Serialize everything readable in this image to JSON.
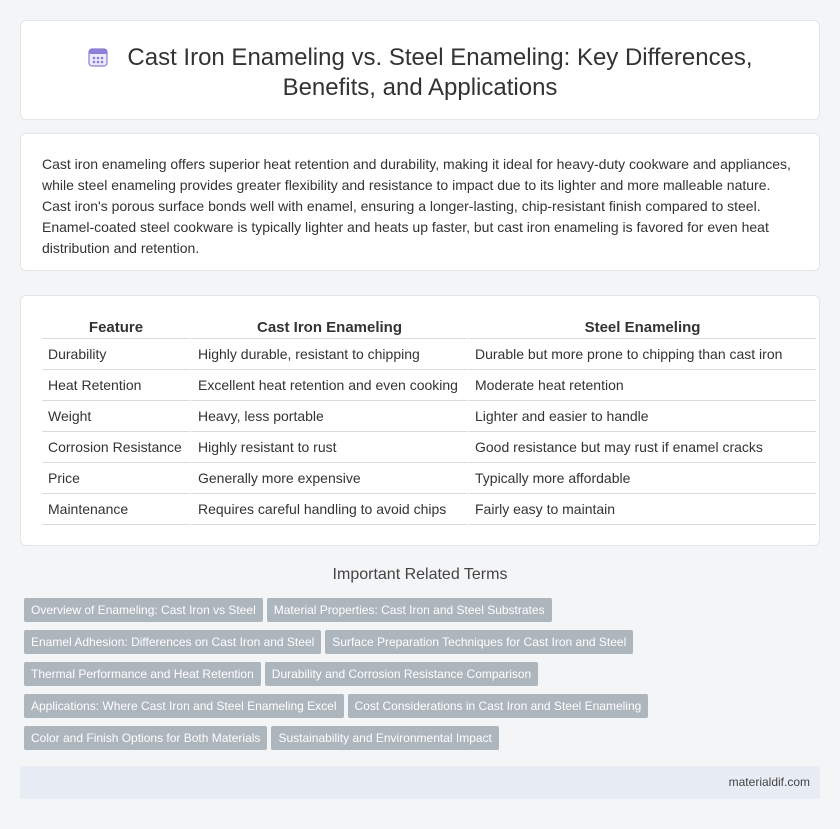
{
  "header": {
    "title_line1": "Cast Iron Enameling vs. Steel Enameling: Key Differences,",
    "title_line2": "Benefits, and Applications",
    "icon": "calendar-grid-icon"
  },
  "summary": "Cast iron enameling offers superior heat retention and durability, making it ideal for heavy-duty cookware and appliances, while steel enameling provides greater flexibility and resistance to impact due to its lighter and more malleable nature. Cast iron's porous surface bonds well with enamel, ensuring a longer-lasting, chip-resistant finish compared to steel. Enamel-coated steel cookware is typically lighter and heats up faster, but cast iron enameling is favored for even heat distribution and retention.",
  "table": {
    "headers": [
      "Feature",
      "Cast Iron Enameling",
      "Steel Enameling"
    ],
    "rows": [
      [
        "Durability",
        "Highly durable, resistant to chipping",
        "Durable but more prone to chipping than cast iron"
      ],
      [
        "Heat Retention",
        "Excellent heat retention and even cooking",
        "Moderate heat retention"
      ],
      [
        "Weight",
        "Heavy, less portable",
        "Lighter and easier to handle"
      ],
      [
        "Corrosion Resistance",
        "Highly resistant to rust",
        "Good resistance but may rust if enamel cracks"
      ],
      [
        "Price",
        "Generally more expensive",
        "Typically more affordable"
      ],
      [
        "Maintenance",
        "Requires careful handling to avoid chips",
        "Fairly easy to maintain"
      ]
    ]
  },
  "related": {
    "title": "Important Related Terms",
    "tags": [
      [
        "Overview of Enameling: Cast Iron vs Steel",
        "Material Properties: Cast Iron and Steel Substrates"
      ],
      [
        "Enamel Adhesion: Differences on Cast Iron and Steel",
        "Surface Preparation Techniques for Cast Iron and Steel"
      ],
      [
        "Thermal Performance and Heat Retention",
        "Durability and Corrosion Resistance Comparison"
      ],
      [
        "Applications: Where Cast Iron and Steel Enameling Excel",
        "Cost Considerations in Cast Iron and Steel Enameling"
      ],
      [
        "Color and Finish Options for Both Materials",
        "Sustainability and Environmental Impact"
      ]
    ]
  },
  "footer": {
    "site": "materialdif.com"
  },
  "colors": {
    "tag_bg": "#adb5bd",
    "footer_bg": "#e8ecf4",
    "icon_accent": "#8b7fd6"
  }
}
